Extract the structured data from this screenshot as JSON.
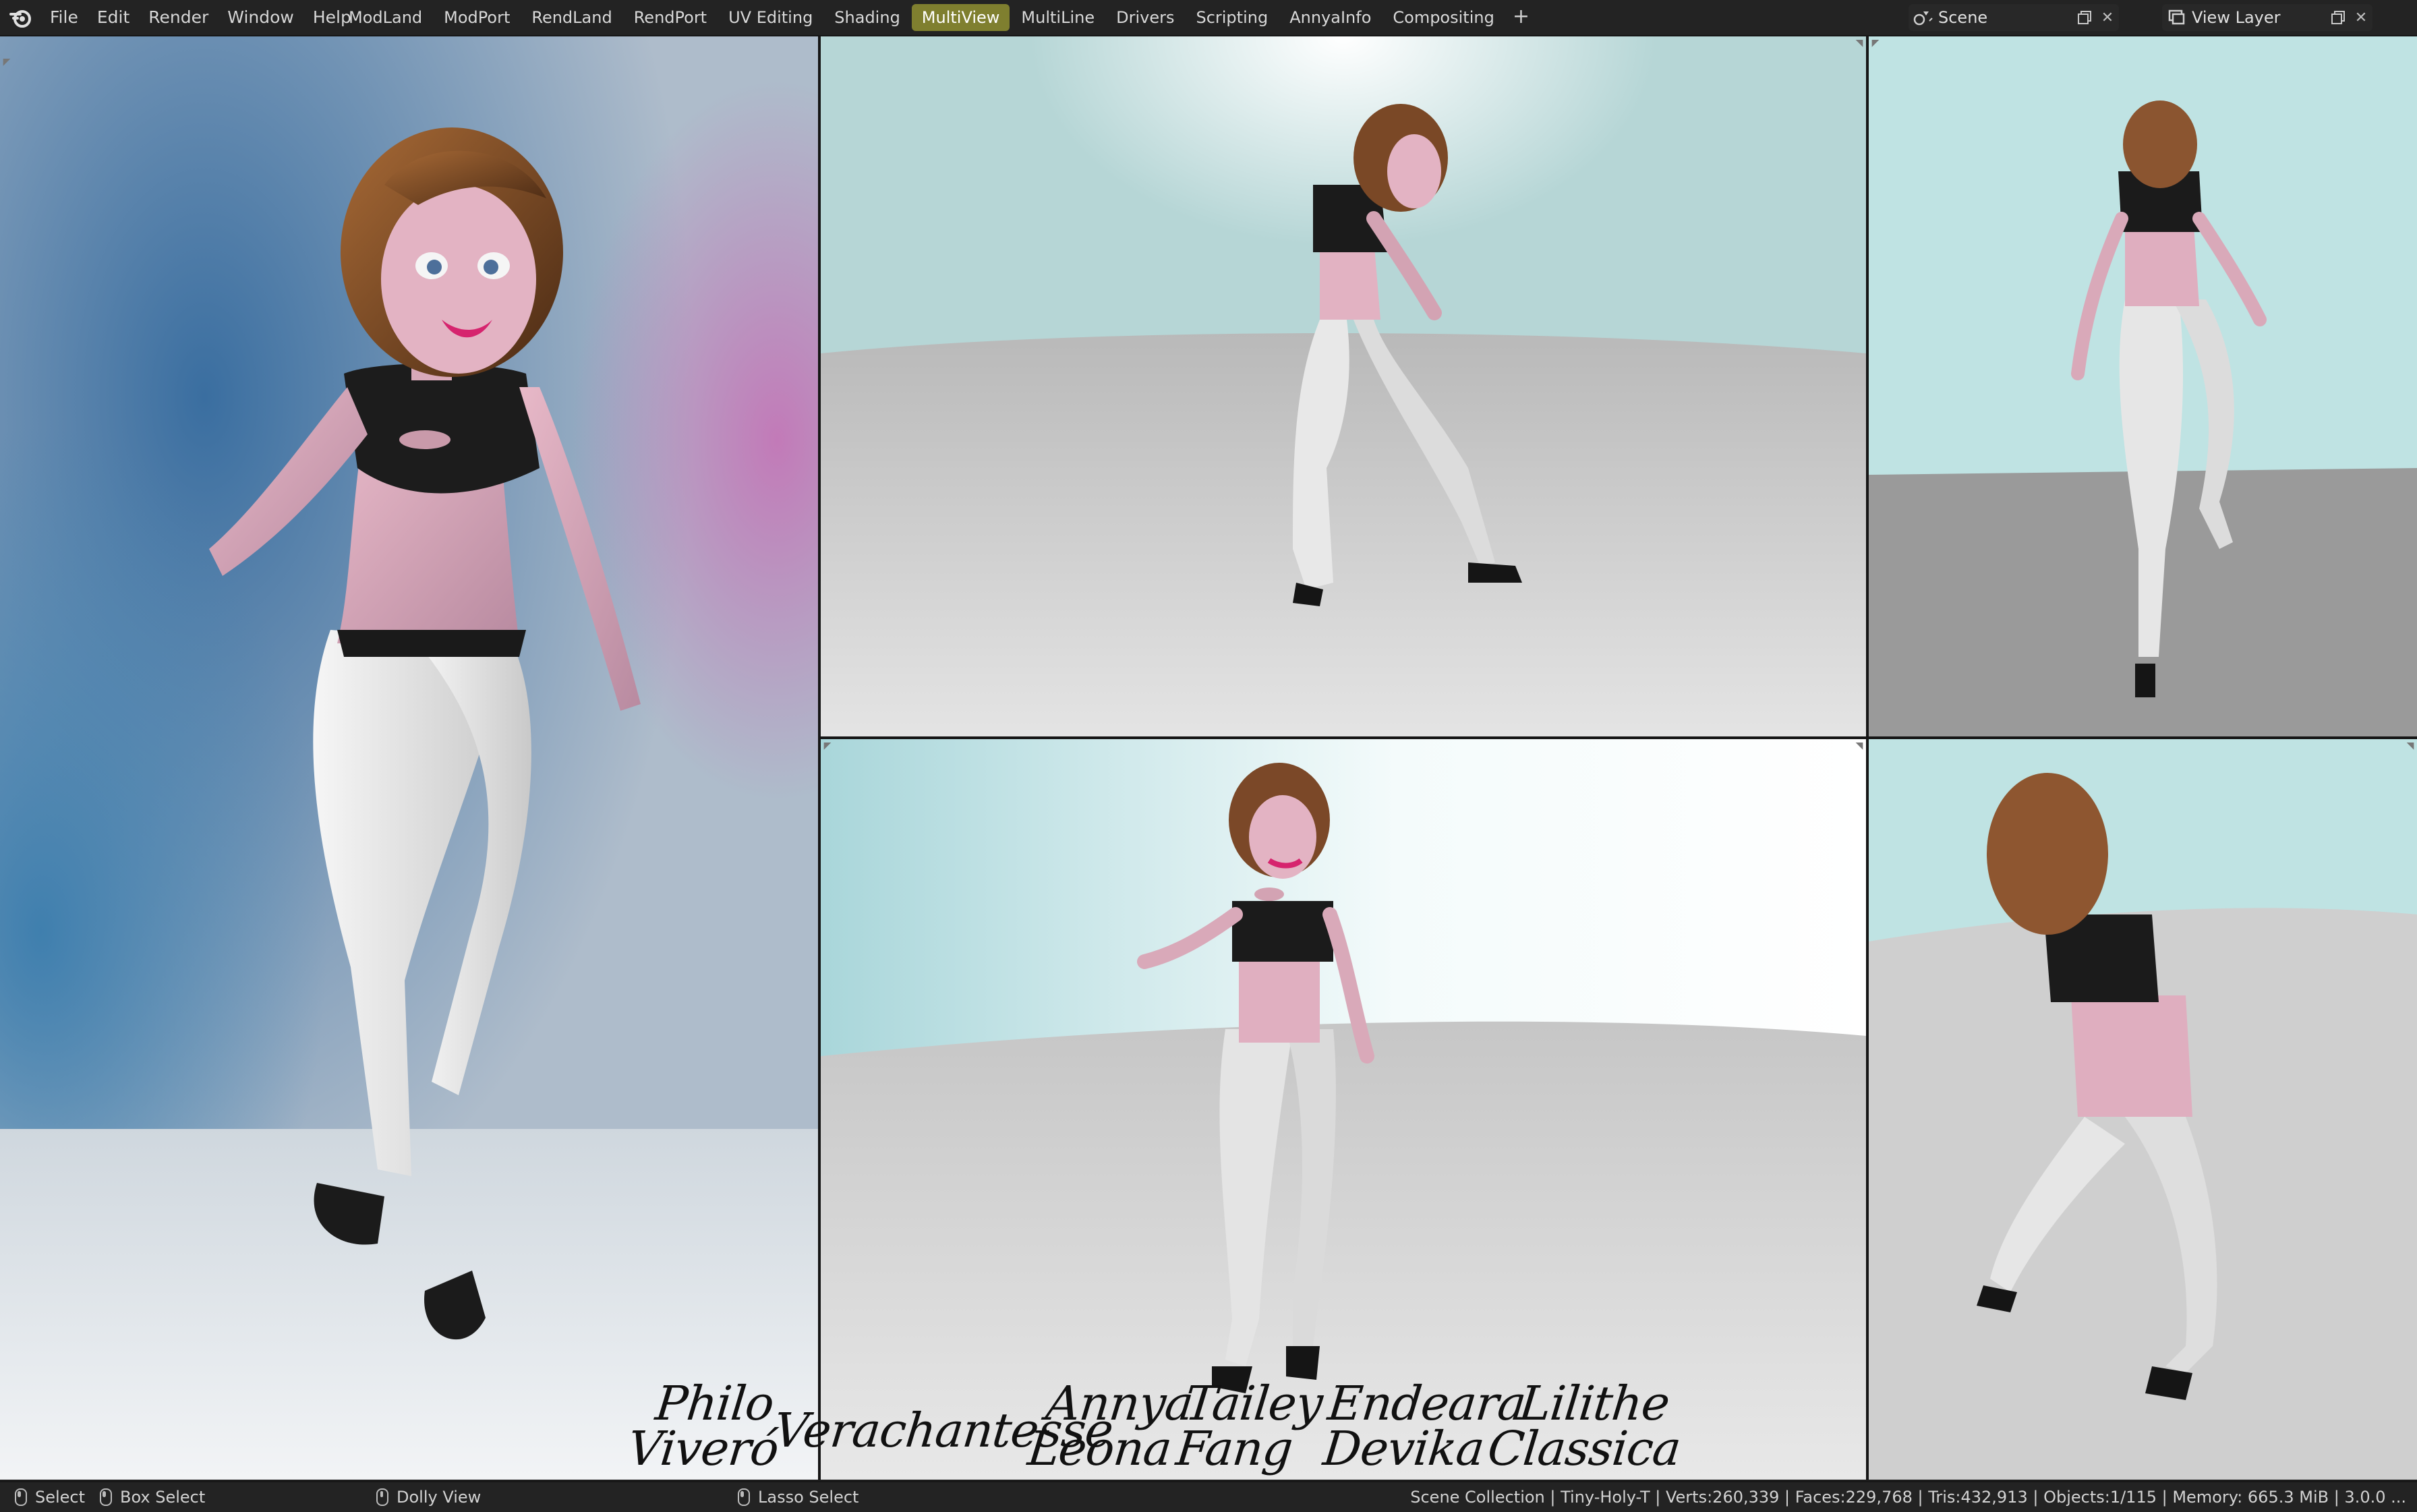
{
  "menu": {
    "items": [
      "File",
      "Edit",
      "Render",
      "Window",
      "Help"
    ]
  },
  "workspaces": {
    "tabs": [
      "ModLand",
      "ModPort",
      "RendLand",
      "RendPort",
      "UV Editing",
      "Shading",
      "MultiView",
      "MultiLine",
      "Drivers",
      "Scripting",
      "AnnyaInfo",
      "Compositing"
    ],
    "active": "MultiView",
    "add_label": "+"
  },
  "scene": {
    "label": "Scene",
    "view_layer": "View Layer"
  },
  "signatures": {
    "s1": [
      "Philo",
      "Viveró"
    ],
    "s2": [
      "Verachantesse"
    ],
    "s3": [
      "Annya",
      "Leona"
    ],
    "s4": [
      "Tailey",
      "Fang"
    ],
    "s5": [
      "Endeara",
      "Devika"
    ],
    "s6": [
      "Lilithe",
      "Classica"
    ]
  },
  "statusbar": {
    "select": "Select",
    "box_select": "Box Select",
    "dolly_view": "Dolly View",
    "lasso_select": "Lasso Select",
    "stats": "Scene Collection | Tiny-Holy-T | Verts:260,339 | Faces:229,768 | Tris:432,913 | Objects:1/115 | Memory: 665.3 MiB | 3.0.0 ..."
  },
  "colors": {
    "active_tab": "#7f7f2f",
    "topbar": "#232323",
    "studio_wall": "#b6d9d8",
    "studio_floor": "#d9d9d9"
  },
  "icons": [
    "blender-logo-icon",
    "scene-icon",
    "view-layer-icon",
    "mouse-left-icon",
    "mouse-right-icon",
    "mouse-middle-icon",
    "copy-icon",
    "close-icon"
  ]
}
